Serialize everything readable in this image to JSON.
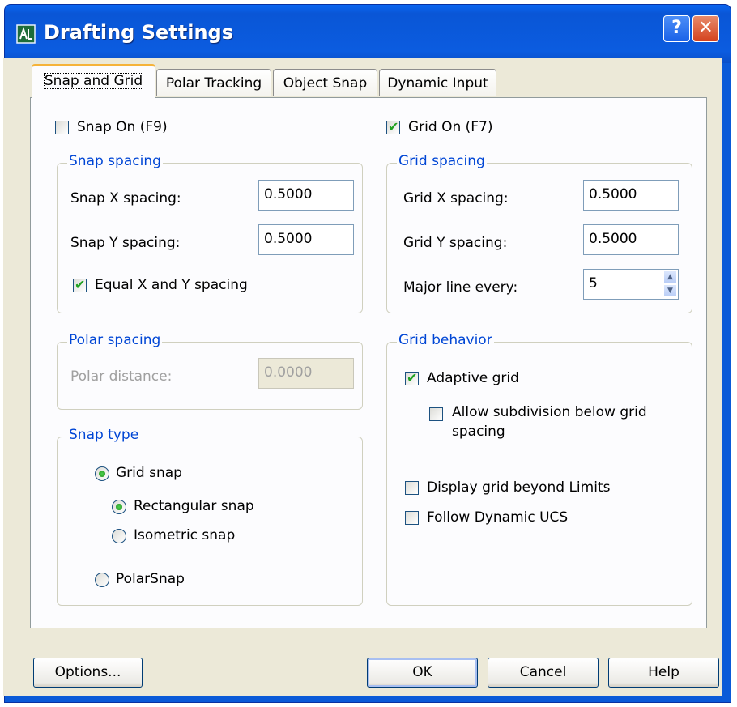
{
  "window": {
    "title": "Drafting Settings",
    "help_glyph": "?",
    "close_glyph": "✕",
    "colors": {
      "titlebar": "#0a56d6",
      "client": "#ece9d8",
      "group_title": "#0046d5",
      "check": "#21a121"
    }
  },
  "tabs": [
    {
      "label": "Snap and Grid",
      "active": true
    },
    {
      "label": "Polar Tracking",
      "active": false
    },
    {
      "label": "Object Snap",
      "active": false
    },
    {
      "label": "Dynamic Input",
      "active": false
    }
  ],
  "snap_on": {
    "label": "Snap On (F9)",
    "checked": false
  },
  "grid_on": {
    "label": "Grid On (F7)",
    "checked": true
  },
  "snap_spacing": {
    "title": "Snap spacing",
    "x_label": "Snap X spacing:",
    "x_value": "0.5000",
    "y_label": "Snap Y spacing:",
    "y_value": "0.5000",
    "equal_label": "Equal X and Y spacing",
    "equal_checked": true
  },
  "polar_spacing": {
    "title": "Polar spacing",
    "distance_label": "Polar distance:",
    "distance_value": "0.0000",
    "enabled": false
  },
  "snap_type": {
    "title": "Snap type",
    "grid_snap": "Grid snap",
    "rectangular": "Rectangular snap",
    "isometric": "Isometric snap",
    "polar": "PolarSnap",
    "selected_type": "Grid snap",
    "selected_style": "Rectangular snap"
  },
  "grid_spacing": {
    "title": "Grid spacing",
    "x_label": "Grid X spacing:",
    "x_value": "0.5000",
    "y_label": "Grid Y spacing:",
    "y_value": "0.5000",
    "major_label": "Major line every:",
    "major_value": "5"
  },
  "grid_behavior": {
    "title": "Grid behavior",
    "adaptive": "Adaptive grid",
    "adaptive_checked": true,
    "subdivision_line1": "Allow subdivision below grid",
    "subdivision_line2": "spacing",
    "subdivision_checked": false,
    "beyond_limits": "Display grid beyond Limits",
    "beyond_checked": false,
    "follow_ucs": "Follow Dynamic UCS",
    "follow_checked": false
  },
  "buttons": {
    "options": "Options...",
    "ok": "OK",
    "cancel": "Cancel",
    "help": "Help"
  }
}
